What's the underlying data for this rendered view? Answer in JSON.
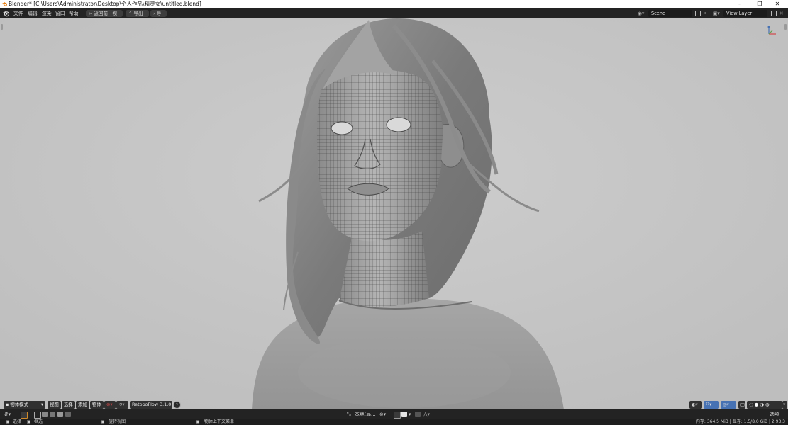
{
  "window": {
    "title": "Blender* [C:\\Users\\Administrator\\Desktop\\个人作品\\精灵女\\untitled.blend]",
    "minimize_glyph": "–",
    "maximize_glyph": "❐",
    "close_glyph": "✕"
  },
  "menu": {
    "items": [
      "文件",
      "编辑",
      "渲染",
      "窗口",
      "帮助"
    ],
    "back_to_previous": "返回前一视图",
    "export": "导出",
    "import": "导入"
  },
  "scene": {
    "name": "Scene",
    "view_layer": "View Layer"
  },
  "viewport_header": {
    "mode": "物体模式",
    "view": "视图",
    "select": "选择",
    "add": "添加",
    "object": "物体",
    "addon": "RetopoFlow 3.1.0",
    "help": "?",
    "transform_orientation": "本地(局…",
    "options": "选项"
  },
  "statusbar": {
    "select": "选择",
    "box_select": "框选",
    "rotate_view": "旋转视图",
    "context_menu": "物体上下文菜单",
    "stats": "内存: 364.5 MiB | 显存: 1.5/8.0 GiB | 2.93.3"
  },
  "colors": {
    "viewport_bg": "#c7c7c7",
    "header_bg": "#232323",
    "accent": "#4772b3",
    "blender_orange": "#e87d0d"
  }
}
